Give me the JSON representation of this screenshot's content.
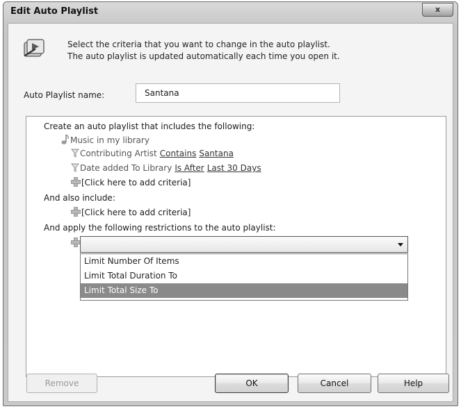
{
  "window": {
    "title": "Edit Auto Playlist",
    "close_glyph": "x"
  },
  "header": {
    "icon": "playlist-edit-icon",
    "line1": "Select the criteria that you want to change in the auto playlist.",
    "line2": "The auto playlist is updated automatically each time you open it."
  },
  "name_field": {
    "label": "Auto Playlist name:",
    "value": "Santana"
  },
  "criteria": {
    "intro": "Create an auto playlist that includes the following:",
    "source": "Music in my library",
    "rules": [
      {
        "field": "Contributing Artist",
        "operator": "Contains",
        "value": "Santana"
      },
      {
        "field": "Date added To Library",
        "operator": "Is After",
        "value": "Last 30 Days"
      }
    ],
    "add_criteria": "[Click here to add criteria]",
    "also_include": "And also include:",
    "add_criteria_2": "[Click here to add criteria]",
    "restrictions_label": "And apply the following restrictions to the auto playlist:"
  },
  "restriction_dropdown": {
    "selected_value": "",
    "options": [
      {
        "label": "Limit Number Of Items",
        "highlighted": false
      },
      {
        "label": "Limit Total Duration To",
        "highlighted": false
      },
      {
        "label": "Limit Total Size To",
        "highlighted": true
      }
    ]
  },
  "buttons": {
    "remove": "Remove",
    "ok": "OK",
    "cancel": "Cancel",
    "help": "Help"
  },
  "colors": {
    "highlight": "#8a8a8a",
    "chrome": "#c9c9c9",
    "panel": "#f4f4f4"
  }
}
